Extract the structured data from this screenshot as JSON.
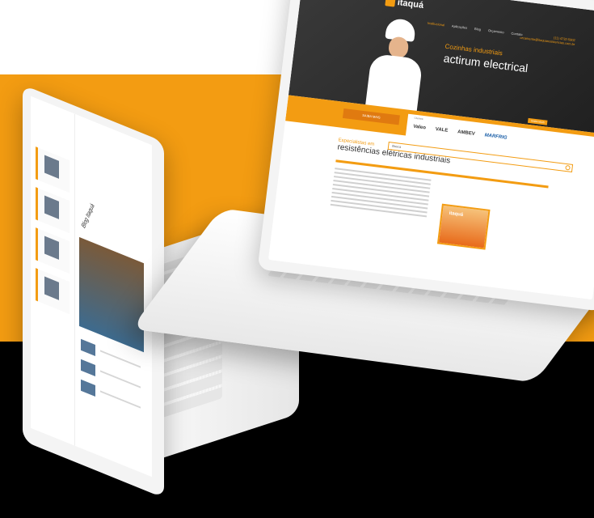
{
  "colors": {
    "accent": "#f39c12",
    "dark": "#222222",
    "background_band": "#000000"
  },
  "right_site": {
    "logo_text": "itaquá",
    "nav": [
      "Institucional",
      "Aplicações",
      "Blog",
      "Orçamento",
      "Contato"
    ],
    "contact_lines": [
      "(11) 4732-5902",
      "orcamento@itaquaresistencias.com.br"
    ],
    "hero_line1": "Cozinhas industriais",
    "hero_line2": "actirum electrical",
    "hero_button": "SAIBA MAIS",
    "promo_button": "SAIBA MAIS",
    "brands_title": "Clientes:",
    "brands": [
      "Valeo",
      "VALE",
      "AMBEV",
      "MARFRIG"
    ],
    "search_value": "Busca",
    "specialty_line1": "Especialistas em",
    "specialty_line2": "resistências elétricas industriais",
    "thumbnail_label": "itaquá"
  },
  "left_site": {
    "blog_title": "Blog Itaquá"
  }
}
